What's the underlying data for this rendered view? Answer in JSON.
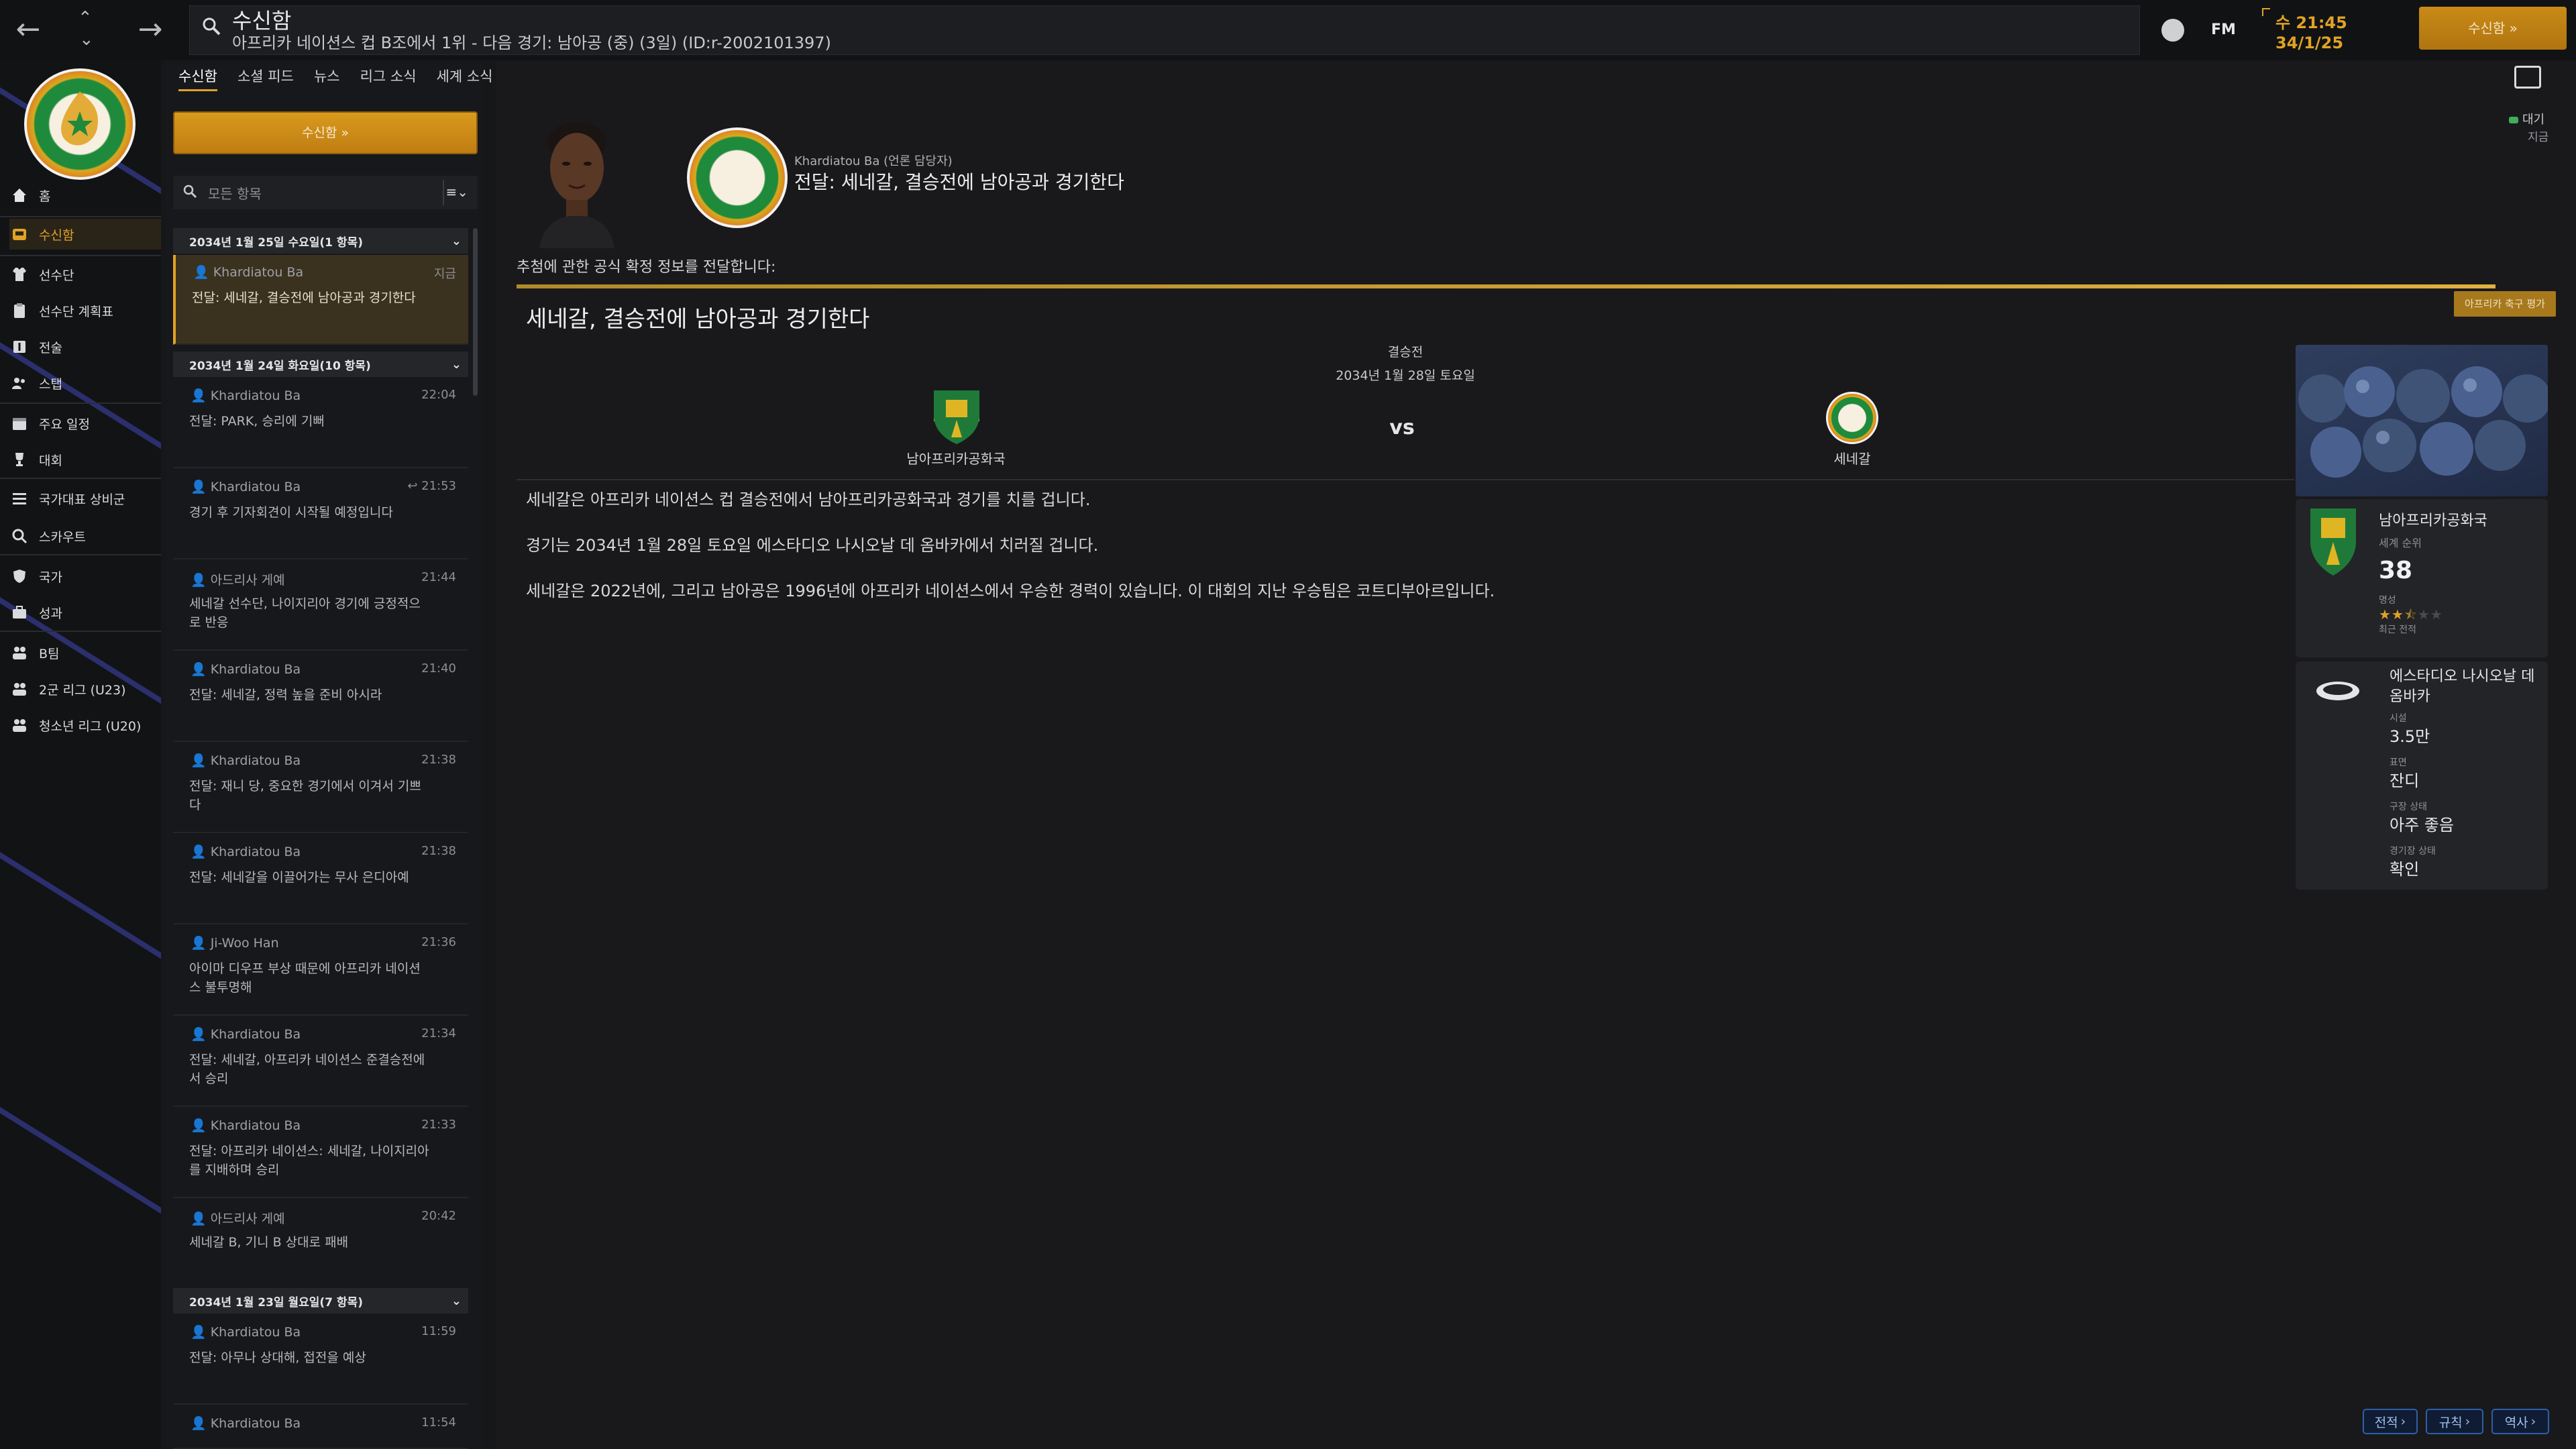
{
  "topbar": {
    "screen_title": "수신함",
    "breadcrumb": "아프리카 네이션스 컵 B조에서 1위 - 다음 경기: 남아공 (중) (3일) (ID:r-2002101397)",
    "fm_label": "FM",
    "clock_time": "수 21:45",
    "clock_date": "34/1/25",
    "inbox_button": "수신함"
  },
  "sidebar": {
    "items": [
      {
        "label": "홈",
        "icon": "home-icon"
      },
      {
        "label": "수신함",
        "icon": "inbox-icon",
        "active": true
      },
      {
        "label": "선수단",
        "icon": "shirt-icon"
      },
      {
        "label": "선수단 계획표",
        "icon": "clipboard-icon"
      },
      {
        "label": "전술",
        "icon": "tactics-icon"
      },
      {
        "label": "스탭",
        "icon": "staff-icon"
      },
      {
        "label": "주요 일정",
        "icon": "calendar-icon"
      },
      {
        "label": "대회",
        "icon": "trophy-icon"
      },
      {
        "label": "국가대표 상비군",
        "icon": "list-icon"
      },
      {
        "label": "스카우트",
        "icon": "search-icon"
      },
      {
        "label": "국가",
        "icon": "shield-icon"
      },
      {
        "label": "성과",
        "icon": "briefcase-icon"
      },
      {
        "label": "B팀",
        "icon": "team-icon"
      },
      {
        "label": "2군 리그 (U23)",
        "icon": "team-icon"
      },
      {
        "label": "청소년 리그 (U20)",
        "icon": "team-icon"
      }
    ]
  },
  "tabs": [
    "수신함",
    "소셜 피드",
    "뉴스",
    "리그 소식",
    "세계 소식"
  ],
  "inbox_panel": {
    "button_label": "수신함",
    "filter_placeholder": "모든 항목",
    "groups": [
      {
        "header": "2034년 1월 25일 수요일(1 항목)",
        "messages": [
          {
            "from": "Khardiatou Ba",
            "time": "지금",
            "subject": "전달: 세네갈, 결승전에 남아공과 경기한다",
            "selected": true
          }
        ]
      },
      {
        "header": "2034년 1월 24일 화요일(10 항목)",
        "messages": [
          {
            "from": "Khardiatou Ba",
            "time": "22:04",
            "subject": "전달: PARK, 승리에 기뻐"
          },
          {
            "from": "Khardiatou Ba",
            "time": "21:53",
            "subject": "경기 후 기자회견이 시작될 예정입니다",
            "replied": true
          },
          {
            "from": "아드리사 게예",
            "time": "21:44",
            "subject": "세네갈 선수단, 나이지리아 경기에 긍정적으로 반응"
          },
          {
            "from": "Khardiatou Ba",
            "time": "21:40",
            "subject": "전달: 세네갈, 정력 높을 준비 아시라"
          },
          {
            "from": "Khardiatou Ba",
            "time": "21:38",
            "subject": "전달: 재니 당, 중요한 경기에서 이겨서 기쁘다"
          },
          {
            "from": "Khardiatou Ba",
            "time": "21:38",
            "subject": "전달: 세네갈을 이끌어가는 무사 은디아예"
          },
          {
            "from": "Ji-Woo Han",
            "time": "21:36",
            "subject": "아이마 디우프 부상 때문에 아프리카 네이션스 불투명해"
          },
          {
            "from": "Khardiatou Ba",
            "time": "21:34",
            "subject": "전달: 세네갈, 아프리카 네이션스 준결승전에서 승리"
          },
          {
            "from": "Khardiatou Ba",
            "time": "21:33",
            "subject": "전달: 아프리카 네이션스: 세네갈, 나이지리아를 지배하며 승리"
          },
          {
            "from": "아드리사 게예",
            "time": "20:42",
            "subject": "세네갈 B, 기니 B 상대로 패배"
          }
        ]
      },
      {
        "header": "2034년 1월 23일 월요일(7 항목)",
        "messages": [
          {
            "from": "Khardiatou Ba",
            "time": "11:59",
            "subject": "전달: 아무나 상대해, 접전을 예상"
          },
          {
            "from": "Khardiatou Ba",
            "time": "11:54",
            "subject": ""
          }
        ]
      }
    ]
  },
  "message": {
    "sender": "Khardiatou Ba",
    "sender_role": "(언론 담당자)",
    "subject": "전달: 세네갈, 결승전에 남아공과 경기한다",
    "status_badge": "대기",
    "status_time": "지금",
    "intro": "추첨에 관한 공식 확정 정보를 전달합니다:",
    "source_tag": "아프리카 축구 평가",
    "headline": "세네갈, 결승전에 남아공과 경기한다",
    "match": {
      "stage": "결승전",
      "date": "2034년 1월 28일 토요일",
      "home": "남아프리카공화국",
      "away": "세네갈",
      "vs": "vs"
    },
    "paragraphs": [
      "세네갈은 아프리카 네이션스 컵 결승전에서 남아프리카공화국과 경기를 치를 겁니다.",
      "경기는 2034년 1월 28일 토요일 에스타디오 나시오날 데 옴바카에서 치러질 겁니다.",
      "세네갈은 2022년에, 그리고 남아공은 1996년에 아프리카 네이션스에서 우승한 경력이 있습니다. 이 대회의 지난 우승팀은 코트디부아르입니다."
    ]
  },
  "opponent_card": {
    "name": "남아프리카공화국",
    "rank_label": "세계 순위",
    "rank": "38",
    "rep_label": "명성",
    "stars": 2.5,
    "form_label": "최근 전적"
  },
  "stadium_card": {
    "name": "에스타디오 나시오날 데 옴바카",
    "capacity_label": "시설",
    "capacity": "3.5만",
    "surface_label": "표면",
    "surface": "잔디",
    "pitch_label": "구장 상태",
    "pitch": "아주 좋음",
    "weather_label": "경기장 상태",
    "weather": "확인"
  },
  "bottom_buttons": [
    "전적",
    "규칙",
    "역사"
  ],
  "colors": {
    "accent": "#e0a325",
    "selected_bg": "#3b311f",
    "button_blue": "#2f5ea8"
  }
}
